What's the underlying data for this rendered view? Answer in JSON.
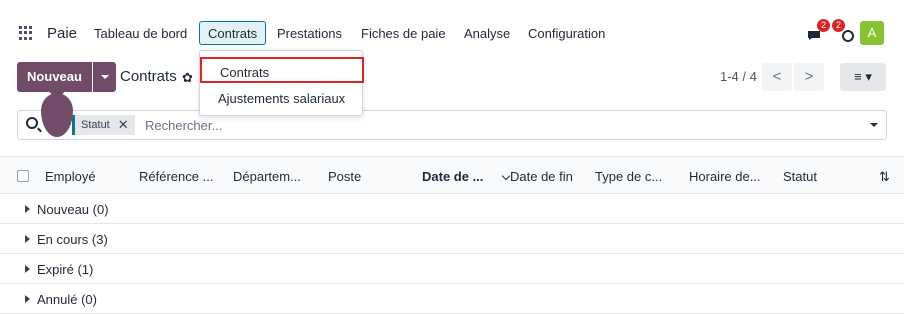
{
  "nav": {
    "app_name": "Paie",
    "menu": [
      "Tableau de bord",
      "Contrats",
      "Prestations",
      "Fiches de paie",
      "Analyse",
      "Configuration"
    ],
    "chat_badge": "2",
    "activity_badge": "2",
    "avatar_initial": "A"
  },
  "control": {
    "new_label": "Nouveau",
    "breadcrumb": "Contrats",
    "pager": "1-4 / 4",
    "prev": "<",
    "next": ">",
    "view_switch": "≡ ▾"
  },
  "dropdown": {
    "items": [
      "Contrats",
      "Ajustements salariaux"
    ]
  },
  "search": {
    "facet_label": "Statut",
    "facet_remove": "✕",
    "placeholder": "Rechercher..."
  },
  "table": {
    "columns": [
      "Employé",
      "Référence ...",
      "Départem...",
      "Poste",
      "Date de ...",
      "Date de fin",
      "Type de c...",
      "Horaire de...",
      "Statut"
    ],
    "groups": [
      "Nouveau (0)",
      "En cours (3)",
      "Expiré (1)",
      "Annulé (0)"
    ]
  },
  "colors": {
    "brand": "#714b67",
    "accent": "#0e7490",
    "badge": "#dc2626",
    "avatar": "#86c232",
    "highlight_border": "#dc2626"
  }
}
